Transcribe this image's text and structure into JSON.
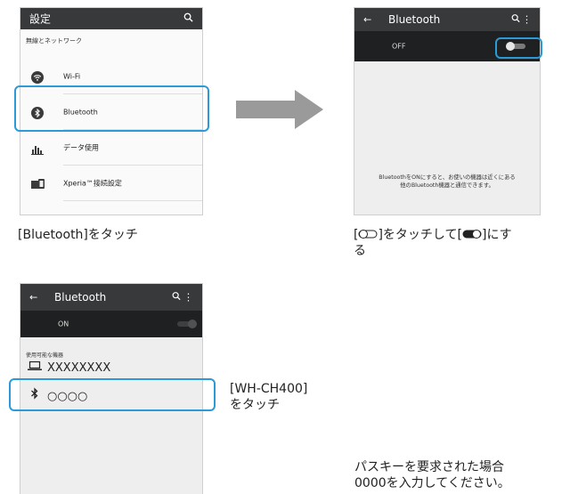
{
  "screen1": {
    "title": "設定",
    "section": "無線とネットワーク",
    "items": [
      {
        "label": "Wi-Fi",
        "icon": "wifi-icon"
      },
      {
        "label": "Bluetooth",
        "icon": "bluetooth-icon"
      },
      {
        "label": "データ使用",
        "icon": "data-usage-icon"
      },
      {
        "label": "Xperia™接続設定",
        "icon": "xperia-connect-icon"
      }
    ],
    "highlight_color": "#2b9ad6"
  },
  "screen2": {
    "title": "Bluetooth",
    "toggle_label": "OFF",
    "toggle_state": false,
    "info_line1": "BluetoothをONにすると、お使いの機器は近くにある",
    "info_line2": "他のBluetooth機器と通信できます。"
  },
  "screen3": {
    "title": "Bluetooth",
    "toggle_label": "ON",
    "toggle_state": true,
    "section": "使用可能な機器",
    "devices": [
      {
        "name": "XXXXXXXX",
        "icon": "laptop-icon"
      },
      {
        "name": "○○○○",
        "icon": "bluetooth-icon"
      }
    ]
  },
  "captions": {
    "step1": "[Bluetooth]をタッチ",
    "step2_a": "[",
    "step2_b": "]をタッチして[",
    "step2_c": "]にす",
    "step2_d": "る",
    "step3_line1": "[WH-CH400]",
    "step3_line2": "をタッチ",
    "passkey_line1": "パスキーを要求された場合",
    "passkey_line2": "0000を入力してください。"
  }
}
